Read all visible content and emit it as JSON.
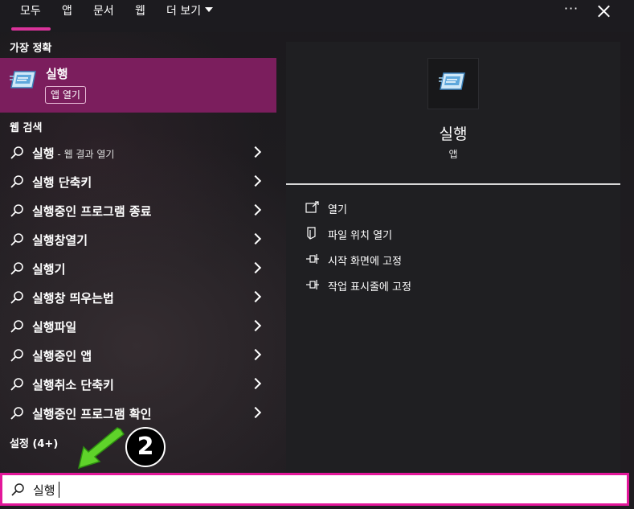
{
  "tabs": [
    {
      "label": "모두",
      "active": true
    },
    {
      "label": "앱"
    },
    {
      "label": "문서"
    },
    {
      "label": "웹"
    },
    {
      "label": "더 보기"
    }
  ],
  "top_actions": {
    "more": "···",
    "close_icon": "close-icon"
  },
  "accent_color": "#7b1e5d",
  "left": {
    "best_match_title": "가장 정확",
    "best_match": {
      "name": "실행",
      "type": "앱 열기"
    },
    "web_search_title": "웹 검색",
    "web_results": [
      {
        "label": "실행",
        "sub": " - 웹 결과 열기"
      },
      {
        "label": "실행 단축키",
        "sub": ""
      },
      {
        "label": "실행중인 프로그램 종료",
        "sub": ""
      },
      {
        "label": "실행창열기",
        "sub": ""
      },
      {
        "label": "실행기",
        "sub": ""
      },
      {
        "label": "실행창 띄우는법",
        "sub": ""
      },
      {
        "label": "실행파일",
        "sub": ""
      },
      {
        "label": "실행중인 앱",
        "sub": ""
      },
      {
        "label": "실행취소 단축키",
        "sub": ""
      },
      {
        "label": "실행중인 프로그램 확인",
        "sub": ""
      }
    ],
    "settings_title": "설정 (4+)"
  },
  "right": {
    "app_name": "실행",
    "app_type": "앱",
    "actions": [
      {
        "label": "열기",
        "icon": "open-icon"
      },
      {
        "label": "파일 위치 열기",
        "icon": "file-location-icon"
      },
      {
        "label": "시작 화면에 고정",
        "icon": "pin-icon"
      },
      {
        "label": "작업 표시줄에 고정",
        "icon": "pin-icon"
      }
    ]
  },
  "callout": {
    "number": "2",
    "arrow_color": "#5fd32a"
  },
  "search": {
    "value": "실행"
  }
}
